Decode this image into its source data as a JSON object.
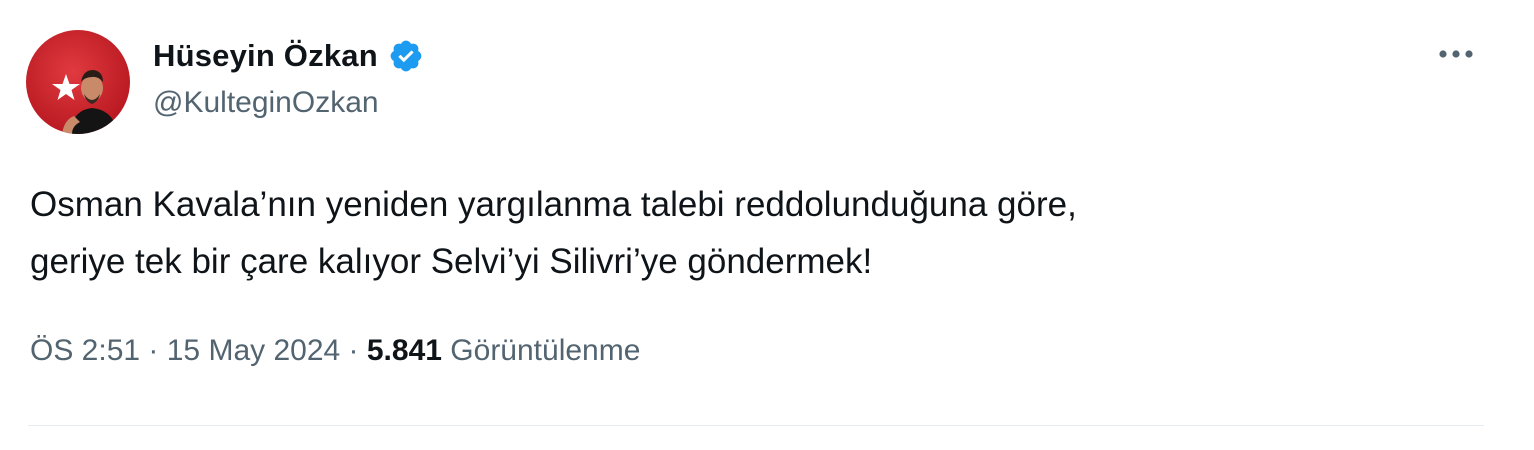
{
  "author": {
    "display_name": "Hüseyin Özkan",
    "handle": "@KulteginOzkan",
    "verified": true
  },
  "tweet": {
    "text": "Osman Kavala’nın yeniden yargılanma talebi reddolunduğuna göre,\ngeriye tek bir çare kalıyor Selvi’yi Silivri’ye göndermek!",
    "time": "ÖS 2:51",
    "separator": " · ",
    "date": "15 May 2024",
    "views_count": "5.841",
    "views_label": "Görüntülenme"
  },
  "icons": {
    "verified": "verified-badge-icon",
    "more": "more-horizontal-icon"
  },
  "colors": {
    "accent": "#1d9bf0",
    "secondary_text": "#536471",
    "primary_text": "#0f1419",
    "avatar_bg": "#d4202a"
  }
}
